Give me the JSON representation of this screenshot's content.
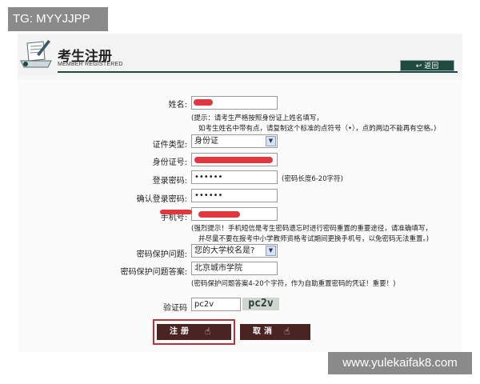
{
  "watermarks": {
    "top_left": "TG: MYYJJPP",
    "bottom_right": "www.yulekaifak8.com"
  },
  "header": {
    "title": "考生注册",
    "subtitle": "MEMBER REGISTERED",
    "return_label": "返回"
  },
  "form": {
    "name": {
      "label": "姓名:"
    },
    "name_hint": {
      "line1": "(提示：请考生严格按照身份证上姓名填写，",
      "line2": "如考生姓名中带有点，请复制这个标准的点符号（•），点的两边不能再有空格。)"
    },
    "id_type": {
      "label": "证件类型:",
      "value": "身份证"
    },
    "id_number": {
      "label": "身份证号:"
    },
    "password": {
      "label": "登录密码:",
      "value": "••••••",
      "hint": "(密码长度6-20字符)"
    },
    "confirm_password": {
      "label": "确认登录密码:",
      "value": "••••••"
    },
    "phone": {
      "label": "手机号:"
    },
    "phone_hint": {
      "line1": "(强烈提示！手机短信是考生密码遗忘时进行密码重置的重要途径，请准确填写，",
      "line2": "并尽量不要在报考中小学教师资格考试期间更换手机号，以免密码无法重置。)"
    },
    "security_question": {
      "label": "密码保护问题:",
      "value": "您的大学校名是?"
    },
    "security_answer": {
      "label": "密码保护问题答案:",
      "value": "北京城市学院",
      "hint": "(密码保护问题答案4-20个字符，作为自助重置密码的凭证！重要！)"
    },
    "captcha": {
      "label": "验证码",
      "value": "pc2v",
      "image_text": "pc2v"
    }
  },
  "buttons": {
    "register": "注册",
    "cancel": "取消"
  },
  "colors": {
    "header_bar": "#1f4a3e",
    "button_bg": "#4a2323",
    "highlight": "#c0303a",
    "redaction": "#e0383e"
  }
}
